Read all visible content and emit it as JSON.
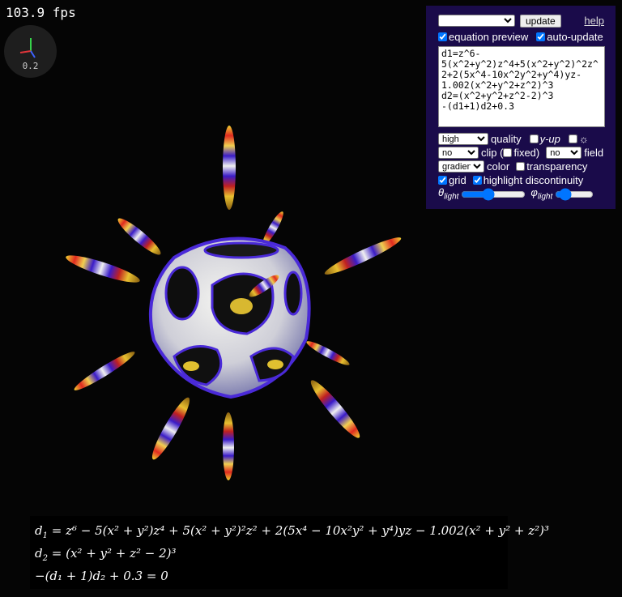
{
  "stats": {
    "fps": "103.9 fps"
  },
  "axes_widget": {
    "scale": "0.2"
  },
  "panel": {
    "function_select_value": "",
    "update_label": "update",
    "help_label": "help",
    "equation_preview_label": "equation preview",
    "equation_preview_checked": true,
    "auto_update_label": "auto-update",
    "auto_update_checked": true,
    "equation_text": "d1=z^6-5(x^2+y^2)z^4+5(x^2+y^2)^2z^2+2(5x^4-10x^2y^2+y^4)yz-1.002(x^2+y^2+z^2)^3\nd2=(x^2+y^2+z^2-2)^3\n-(d1+1)d2+0.3",
    "quality_value": "high",
    "quality_label": "quality",
    "y_up_label": "y-up",
    "light_toggle_label": "☼",
    "clip_value": "no",
    "clip_label": "clip (",
    "fixed_label": "fixed)",
    "field_value": "no",
    "field_label": "field",
    "color_value": "gradient",
    "color_label": "color",
    "transparency_label": "transparency",
    "grid_label": "grid",
    "grid_checked": true,
    "highlight_label": "highlight discontinuity",
    "highlight_checked": true,
    "theta_symbol": "θ",
    "phi_symbol": "φ",
    "light_subscript": "light",
    "theta_value": 40,
    "phi_value": 15
  },
  "formula": {
    "line1_lhs": "d",
    "line1_sub": "1",
    "line1_rhs": "= z⁶ − 5(x² + y²)z⁴ + 5(x² + y²)²z² + 2(5x⁴ − 10x²y² + y⁴)yz − 1.002(x² + y² + z²)³",
    "line2_lhs": "d",
    "line2_sub": "2",
    "line2_rhs": "= (x² + y² + z² − 2)³",
    "line3": "−(d₁ + 1)d₂ + 0.3 = 0"
  },
  "colors": {
    "background": "#050505",
    "panel_bg": "#1a0b4a",
    "surface_highlight": "#5a3be0",
    "spike_yellow": "#f0c020",
    "spike_red": "#c01818",
    "spike_purple": "#4a2ad0"
  }
}
